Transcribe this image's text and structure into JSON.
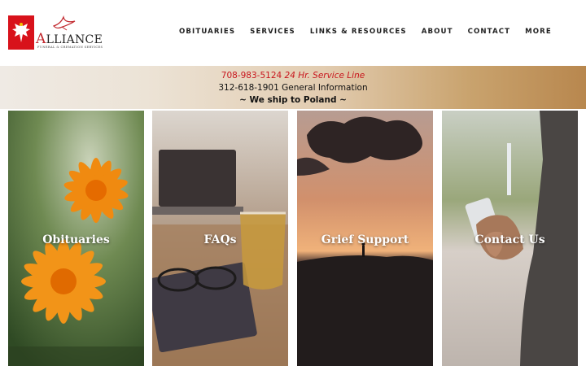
{
  "brand": {
    "name_first": "A",
    "name_rest": "LLIANCE",
    "tagline": "FUNERAL & CREMATION SERVICES"
  },
  "nav": {
    "items": [
      {
        "label": "OBITUARIES"
      },
      {
        "label": "SERVICES"
      },
      {
        "label": "LINKS & RESOURCES"
      },
      {
        "label": "ABOUT"
      },
      {
        "label": "CONTACT"
      },
      {
        "label": "MORE"
      }
    ]
  },
  "info": {
    "service_phone": "708-983-5124",
    "service_text": "24 Hr. Service Line",
    "general_phone": "312-618-1901",
    "general_text": "General Information",
    "ship_text": "~ We ship to Poland ~"
  },
  "tiles": [
    {
      "label": "Obituaries",
      "icon": "orange-flower-image"
    },
    {
      "label": "FAQs",
      "icon": "glasses-notebook-tea-image"
    },
    {
      "label": "Grief Support",
      "icon": "sunset-figure-image"
    },
    {
      "label": "Contact Us",
      "icon": "phone-hand-image"
    }
  ],
  "colors": {
    "brand_red": "#d8121b",
    "service_line_red": "#c8161d",
    "band_gold": "#b8874e"
  }
}
